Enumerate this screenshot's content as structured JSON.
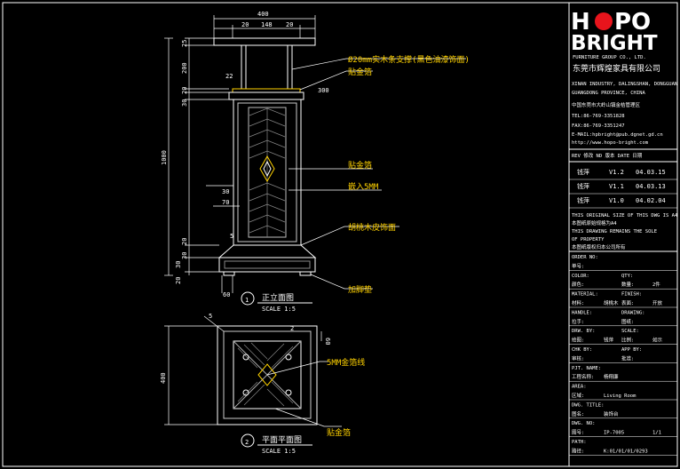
{
  "logo": {
    "line1_left": "H",
    "line1_right": "PO",
    "line2": "BRIGHT",
    "group": "FURNITURE GROUP CO., LTD.",
    "company_cn": "东莞市辉煌家具有限公司",
    "colors": {
      "red": "#e8141c",
      "white": "#ffffff"
    }
  },
  "company_info": {
    "addr_en1": "XINAN INDUSTRY, DALINGSHAN, DONGGUAN",
    "addr_en2": "GUANGDONG PROVINCE, CHINA",
    "addr_cn": "中国东莞市大岭山镇金桔管理区",
    "tel": "TEL:86-769-3351828",
    "fax": "FAX:86-769-3351247",
    "email": "E-MAIL:hpbright@pub.dgnet.gd.cn",
    "web": "http://www.hopo-bright.com"
  },
  "revisions": {
    "header": "REV 修改  ND 版本  DATE 日期",
    "rows": [
      {
        "by": "钱萍",
        "ver": "V1.2",
        "date": "04.03.15"
      },
      {
        "by": "钱萍",
        "ver": "V1.1",
        "date": "04.03.13"
      },
      {
        "by": "钱萍",
        "ver": "V1.0",
        "date": "04.02.04"
      }
    ]
  },
  "notes": {
    "n1": "THIS ORIGINAL SIZE OF THIS DWG IS A4",
    "n1_cn": "本图纸原始规格为A4",
    "n2": "THIS DRAWING REMAINS THE SOLE",
    "n3": "OF PROPERTY",
    "n3_cn": "本图纸版权归本公司所有"
  },
  "fields": [
    {
      "k": "ORDER NO:",
      "k2": "",
      "v": "",
      "v2": ""
    },
    {
      "k": "单号:",
      "k2": "",
      "v": "",
      "v2": ""
    },
    {
      "k": "COLOR:",
      "k2": "QTY:",
      "v": "",
      "v2": ""
    },
    {
      "k": "颜色:",
      "k2": "数量:",
      "v": "",
      "v2": "2件"
    },
    {
      "k": "MATERIAL:",
      "k2": "FINISH:",
      "v": "",
      "v2": ""
    },
    {
      "k": "材料:",
      "k2": "表面:",
      "v": "胡桃木",
      "v2": "开放"
    },
    {
      "k": "HANDLE:",
      "k2": "DRAWING:",
      "v": "",
      "v2": ""
    },
    {
      "k": "拉手:",
      "k2": "图纸:",
      "v": "",
      "v2": ""
    },
    {
      "k": "DRW. BY:",
      "k2": "SCALE:",
      "v": "",
      "v2": ""
    },
    {
      "k": "绘图:",
      "k2": "比例:",
      "v": "钱萍",
      "v2": "如示"
    },
    {
      "k": "CHK BY:",
      "k2": "APP BY:",
      "v": "",
      "v2": ""
    },
    {
      "k": "审核:",
      "k2": "批准:",
      "v": "",
      "v2": ""
    },
    {
      "k": "PJT. NAME:",
      "k2": "",
      "v": "",
      "v2": ""
    },
    {
      "k": "工程名称:",
      "k2": "",
      "v": "杨翔廉",
      "v2": ""
    },
    {
      "k": "AREA:",
      "k2": "",
      "v": "",
      "v2": ""
    },
    {
      "k": "区域:",
      "k2": "",
      "v": "Living Room",
      "v2": ""
    },
    {
      "k": "DWG. TITLE:",
      "k2": "",
      "v": "",
      "v2": ""
    },
    {
      "k": "图名:",
      "k2": "",
      "v": "装饰台",
      "v2": ""
    },
    {
      "k": "DWG. NO:",
      "k2": "",
      "v": "",
      "v2": ""
    },
    {
      "k": "图号:",
      "k2": "",
      "v": "IP-7005",
      "v2": "1/1"
    },
    {
      "k": "PATH:",
      "k2": "",
      "v": "",
      "v2": ""
    },
    {
      "k": "路径:",
      "k2": "",
      "v": "K:01/01/01/0293",
      "v2": ""
    }
  ],
  "elevation": {
    "dims_top": {
      "overall": "400",
      "a": "20",
      "b": "148",
      "c": "20"
    },
    "dims_left": [
      "25",
      "200",
      "20",
      "30",
      "1000",
      "30",
      "70",
      "5",
      "20",
      "30",
      "30",
      "20"
    ],
    "dim_22": "22",
    "dim_300": "300",
    "dim_60": "60",
    "callouts": [
      "Ø20mm实木条支撑(黑色油漆饰面)",
      "贴金箔",
      "贴金箔",
      "嵌入5MM",
      "胡桃木皮饰面",
      "加脚垫"
    ],
    "title_num": "1",
    "title": "正立面图",
    "scale": "SCALE 1:5"
  },
  "plan": {
    "dim_400": "400",
    "dim_60": "60",
    "dim_5": "5",
    "dim_2": "2",
    "callouts": [
      "5MM金箔线",
      "贴金箔"
    ],
    "title_num": "2",
    "title": "平面平面图",
    "scale": "SCALE 1:5"
  }
}
